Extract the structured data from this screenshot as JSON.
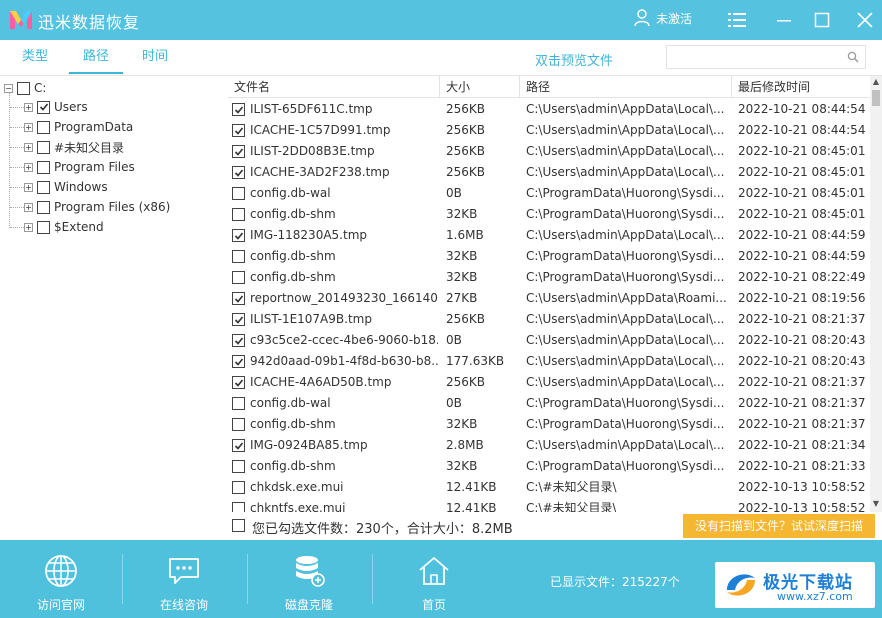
{
  "titlebar": {
    "app_title": "迅米数据恢复",
    "user_status": "未激活",
    "icons": [
      "app-logo-icon",
      "user-icon",
      "menu-icon",
      "minimize-icon",
      "maximize-icon",
      "close-icon"
    ]
  },
  "tabs": [
    {
      "label": "类型"
    },
    {
      "label": "路径"
    },
    {
      "label": "时间"
    }
  ],
  "active_tab": "路径",
  "preview_hint": "双击预览文件",
  "search": {
    "placeholder": ""
  },
  "tree": {
    "root": {
      "label": "C:",
      "checked": false
    },
    "children": [
      {
        "label": "Users",
        "checked": true
      },
      {
        "label": "ProgramData",
        "checked": false
      },
      {
        "label": "#未知父目录",
        "checked": false
      },
      {
        "label": "Program Files",
        "checked": false
      },
      {
        "label": "Windows",
        "checked": false
      },
      {
        "label": "Program Files (x86)",
        "checked": false
      },
      {
        "label": "$Extend",
        "checked": false
      }
    ]
  },
  "table": {
    "columns": [
      "文件名",
      "大小",
      "路径",
      "最后修改时间"
    ],
    "rows": [
      {
        "checked": true,
        "name": "ILIST-65DF611C.tmp",
        "size": "256KB",
        "path": "C:\\Users\\admin\\AppData\\Local\\...",
        "time": "2022-10-21 08:44:54"
      },
      {
        "checked": true,
        "name": "ICACHE-1C57D991.tmp",
        "size": "256KB",
        "path": "C:\\Users\\admin\\AppData\\Local\\...",
        "time": "2022-10-21 08:44:54"
      },
      {
        "checked": true,
        "name": "ILIST-2DD08B3E.tmp",
        "size": "256KB",
        "path": "C:\\Users\\admin\\AppData\\Local\\...",
        "time": "2022-10-21 08:45:01"
      },
      {
        "checked": true,
        "name": "ICACHE-3AD2F238.tmp",
        "size": "256KB",
        "path": "C:\\Users\\admin\\AppData\\Local\\...",
        "time": "2022-10-21 08:45:01"
      },
      {
        "checked": false,
        "name": "config.db-wal",
        "size": "0B",
        "path": "C:\\ProgramData\\Huorong\\Sysdi...",
        "time": "2022-10-21 08:45:01"
      },
      {
        "checked": false,
        "name": "config.db-shm",
        "size": "32KB",
        "path": "C:\\ProgramData\\Huorong\\Sysdi...",
        "time": "2022-10-21 08:45:01"
      },
      {
        "checked": true,
        "name": "IMG-118230A5.tmp",
        "size": "1.6MB",
        "path": "C:\\Users\\admin\\AppData\\Local\\...",
        "time": "2022-10-21 08:44:59"
      },
      {
        "checked": false,
        "name": "config.db-shm",
        "size": "32KB",
        "path": "C:\\ProgramData\\Huorong\\Sysdi...",
        "time": "2022-10-21 08:44:59"
      },
      {
        "checked": false,
        "name": "config.db-shm",
        "size": "32KB",
        "path": "C:\\ProgramData\\Huorong\\Sysdi...",
        "time": "2022-10-21 08:22:49"
      },
      {
        "checked": true,
        "name": "reportnow_201493230_166140...",
        "size": "27KB",
        "path": "C:\\Users\\admin\\AppData\\Roami...",
        "time": "2022-10-21 08:19:56"
      },
      {
        "checked": true,
        "name": "ILIST-1E107A9B.tmp",
        "size": "256KB",
        "path": "C:\\Users\\admin\\AppData\\Local\\...",
        "time": "2022-10-21 08:21:37"
      },
      {
        "checked": true,
        "name": "c93c5ce2-ccec-4be6-9060-b18...",
        "size": "0B",
        "path": "C:\\Users\\admin\\AppData\\Local\\...",
        "time": "2022-10-21 08:20:43"
      },
      {
        "checked": true,
        "name": "942d0aad-09b1-4f8d-b630-b8...",
        "size": "177.63KB",
        "path": "C:\\Users\\admin\\AppData\\Local\\...",
        "time": "2022-10-21 08:20:43"
      },
      {
        "checked": true,
        "name": "ICACHE-4A6AD50B.tmp",
        "size": "256KB",
        "path": "C:\\Users\\admin\\AppData\\Local\\...",
        "time": "2022-10-21 08:21:37"
      },
      {
        "checked": false,
        "name": "config.db-wal",
        "size": "0B",
        "path": "C:\\ProgramData\\Huorong\\Sysdi...",
        "time": "2022-10-21 08:21:37"
      },
      {
        "checked": false,
        "name": "config.db-shm",
        "size": "32KB",
        "path": "C:\\ProgramData\\Huorong\\Sysdi...",
        "time": "2022-10-21 08:21:37"
      },
      {
        "checked": true,
        "name": "IMG-0924BA85.tmp",
        "size": "2.8MB",
        "path": "C:\\Users\\admin\\AppData\\Local\\...",
        "time": "2022-10-21 08:21:34"
      },
      {
        "checked": false,
        "name": "config.db-shm",
        "size": "32KB",
        "path": "C:\\ProgramData\\Huorong\\Sysdi...",
        "time": "2022-10-21 08:21:33"
      },
      {
        "checked": false,
        "name": "chkdsk.exe.mui",
        "size": "12.41KB",
        "path": "C:\\#未知父目录\\",
        "time": "2022-10-13 10:58:52"
      },
      {
        "checked": false,
        "name": "chkntfs.exe.mui",
        "size": "12.41KB",
        "path": "C:\\#未知父目录\\",
        "time": "2022-10-13 10:58:52"
      }
    ]
  },
  "status": {
    "selected_text": "您已勾选文件数：230个，合计大小：8.2MB",
    "deep_scan_label": "没有扫描到文件？试试深度扫描"
  },
  "bottom_nav": [
    {
      "label": "访问官网",
      "icon": "globe-icon"
    },
    {
      "label": "在线咨询",
      "icon": "chat-icon"
    },
    {
      "label": "磁盘克隆",
      "icon": "database-icon"
    },
    {
      "label": "首页",
      "icon": "home-icon"
    }
  ],
  "files_shown": "已显示文件：215227个",
  "watermark": {
    "title": "极光下载站",
    "url": "www.xz7.com"
  },
  "colors": {
    "accent": "#3fb6d8",
    "titlebar": "#55c2e0",
    "bottombar": "#4fc1dd",
    "deep_scan": "#f5b632"
  }
}
